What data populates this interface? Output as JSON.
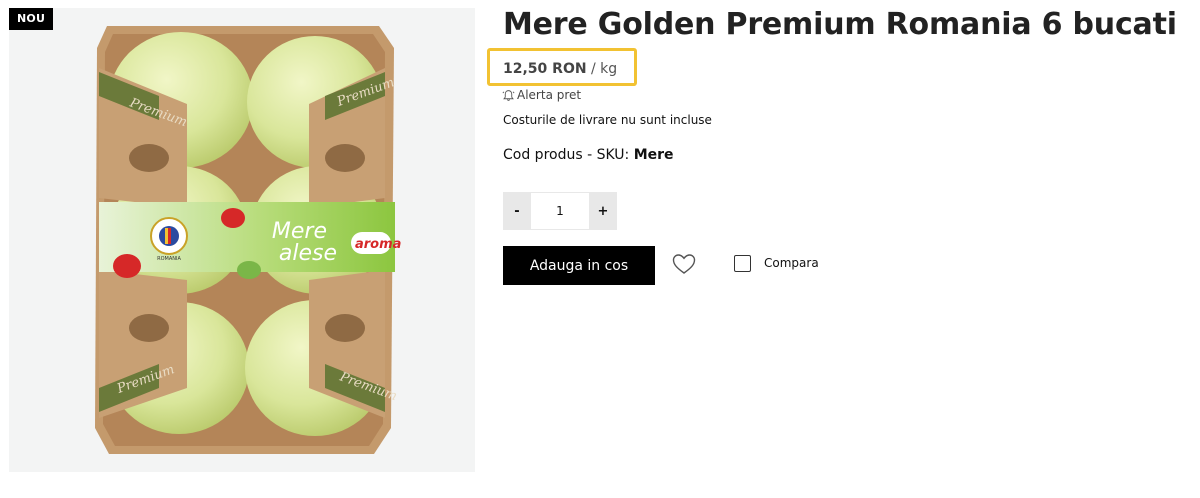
{
  "product": {
    "badge": "NOU",
    "title": "Mere Golden Premium Romania 6 bucati",
    "price": {
      "amount": "12,50 RON",
      "unit": "/ kg"
    },
    "price_alert_label": "Alerta pret",
    "delivery_note": "Costurile de livrare nu sunt incluse",
    "sku": {
      "label": "Cod produs - SKU:",
      "value": "Mere"
    },
    "quantity": {
      "value": "1",
      "minus_label": "-",
      "plus_label": "+"
    },
    "add_to_cart_label": "Adauga in cos",
    "compare_label": "Compara",
    "image": {
      "band_text_line1": "Mere",
      "band_text_line2": "alese",
      "band_brand": "aroma",
      "side_label": "Premium",
      "seal_text": "ROMANIA"
    }
  },
  "colors": {
    "highlight": "#f2c232",
    "button_bg": "#000000",
    "apple": "#d9e69a",
    "cardboard": "#c49a6c",
    "band_green": "#8cc63f"
  },
  "icons": {
    "alert": "bell-icon",
    "wishlist": "heart-icon",
    "compare": "checkbox"
  }
}
